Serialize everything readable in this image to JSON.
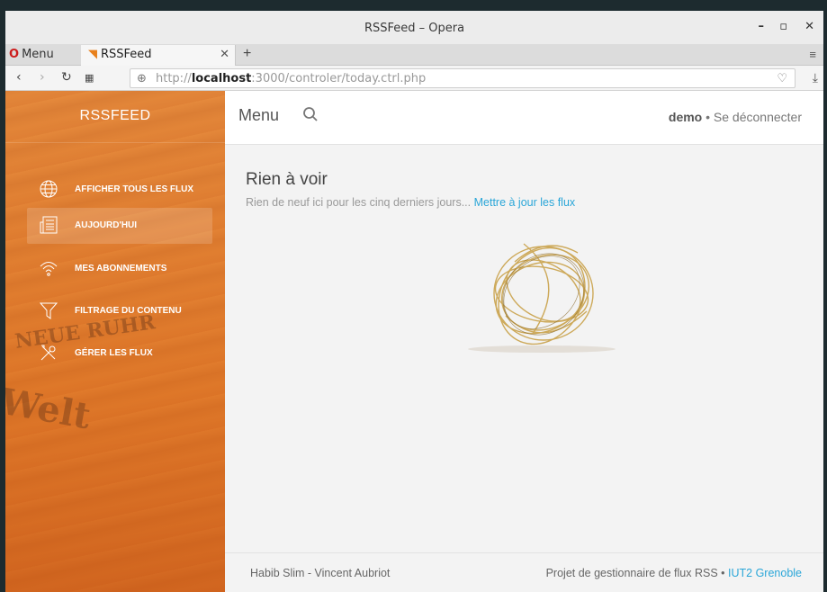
{
  "window": {
    "title": "RSSFeed – Opera",
    "minimize": "–",
    "maximize": "▫",
    "close": "✕"
  },
  "tabbar": {
    "menu_label": "Menu",
    "tab_title": "RSSFeed",
    "tab_close": "✕",
    "new_tab": "+"
  },
  "address": {
    "protocol": "http://",
    "host": "localhost",
    "rest": ":3000/controler/today.ctrl.php"
  },
  "sidebar": {
    "brand": "RSSFEED",
    "items": [
      {
        "label": "AFFICHER TOUS LES FLUX",
        "icon": "globe-icon"
      },
      {
        "label": "AUJOURD'HUI",
        "icon": "newspaper-icon"
      },
      {
        "label": "MES ABONNEMENTS",
        "icon": "wifi-icon"
      },
      {
        "label": "FILTRAGE DU CONTENU",
        "icon": "filter-icon"
      },
      {
        "label": "GÉRER LES FLUX",
        "icon": "tools-icon"
      }
    ],
    "active_index": 1
  },
  "topnav": {
    "menu_label": "Menu",
    "username": "demo",
    "separator": " • ",
    "logout": "Se déconnecter"
  },
  "content": {
    "heading": "Rien à voir",
    "message": "Rien de neuf ici pour les cinq derniers jours... ",
    "refresh_link": "Mettre à jour les flux"
  },
  "footer": {
    "authors": "Habib Slim - Vincent Aubriot",
    "project": "Projet de gestionnaire de flux RSS",
    "separator": " • ",
    "school": "IUT2 Grenoble"
  },
  "colors": {
    "accent": "#2aa6d8",
    "sidebar": "#e2852f"
  }
}
